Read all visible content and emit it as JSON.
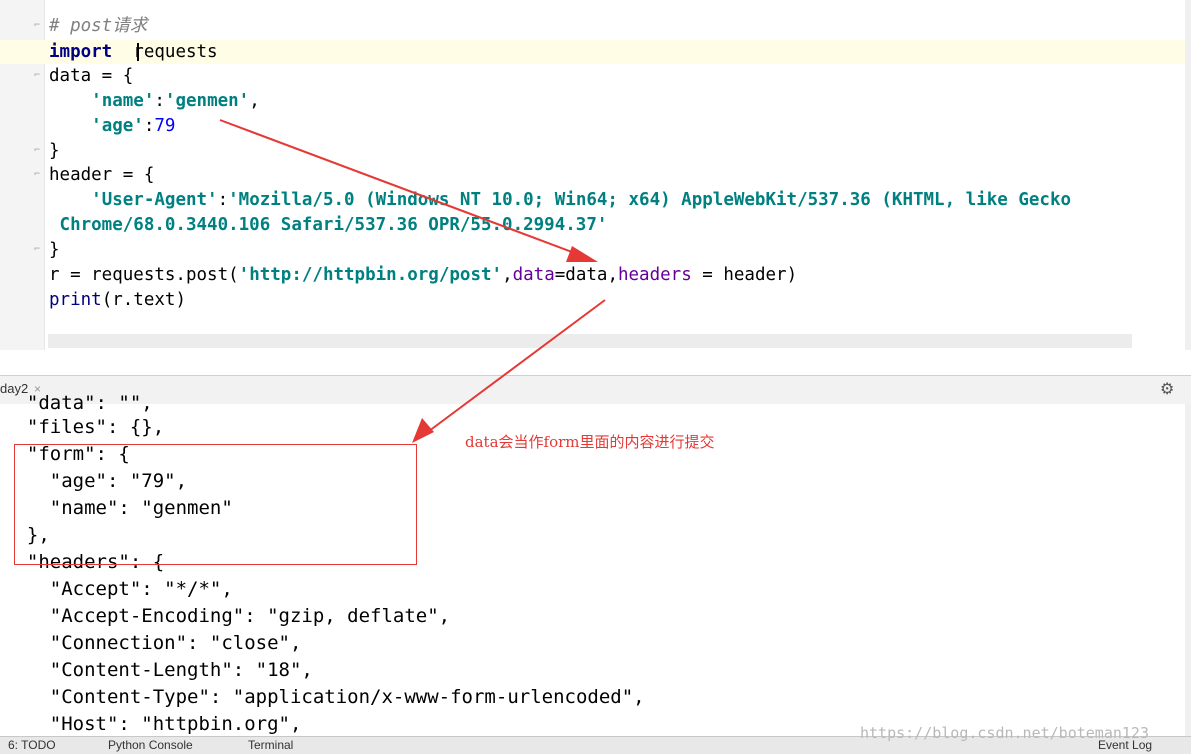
{
  "editor": {
    "lines": {
      "l1": "# post请求",
      "l2a": "import",
      "l2b": "  re",
      "l2c": "quests",
      "l3": "data = {",
      "l4a": "    ",
      "l4b": "'name'",
      "l4c": ":",
      "l4d": "'genmen'",
      "l4e": ",",
      "l5a": "    ",
      "l5b": "'age'",
      "l5c": ":",
      "l5d": "79",
      "l6": "}",
      "l7": "header = {",
      "l8a": "    ",
      "l8b": "'User-Agent'",
      "l8c": ":",
      "l8d": "'Mozilla/5.0 (Windows NT 10.0; Win64; x64) AppleWebKit/537.36 (KHTML, like Gecko",
      "l9": " Chrome/68.0.3440.106 Safari/537.36 OPR/55.0.2994.37'",
      "l10": "}",
      "l11a": "r = requests.post(",
      "l11b": "'http://httpbin.org/post'",
      "l11c": ",",
      "l11d": "data",
      "l11e": "=data,",
      "l11f": "headers",
      "l11g": " = header)",
      "l12a": "print",
      "l12b": "(r.text)"
    }
  },
  "run_panel": {
    "tab_label": "day2",
    "tab_close": "×",
    "settings_icon": "gear-icon",
    "settings_glyph": "⚙"
  },
  "console": {
    "lines": [
      "  \"data\": \"\",",
      "  \"files\": {},",
      "  \"form\": {",
      "    \"age\": \"79\",",
      "    \"name\": \"genmen\"",
      "  },",
      "  \"headers\": {",
      "    \"Accept\": \"*/*\",",
      "    \"Accept-Encoding\": \"gzip, deflate\",",
      "    \"Connection\": \"close\",",
      "    \"Content-Length\": \"18\",",
      "    \"Content-Type\": \"application/x-www-form-urlencoded\",",
      "    \"Host\": \"httpbin.org\","
    ]
  },
  "annotation": {
    "text": "data会当作form里面的内容进行提交",
    "color": "#e53935"
  },
  "bottom_bar": {
    "todo": "6: TODO",
    "python_console": "Python Console",
    "terminal": "Terminal",
    "event_log": "Event Log"
  },
  "watermark": "https://blog.csdn.net/boteman123"
}
